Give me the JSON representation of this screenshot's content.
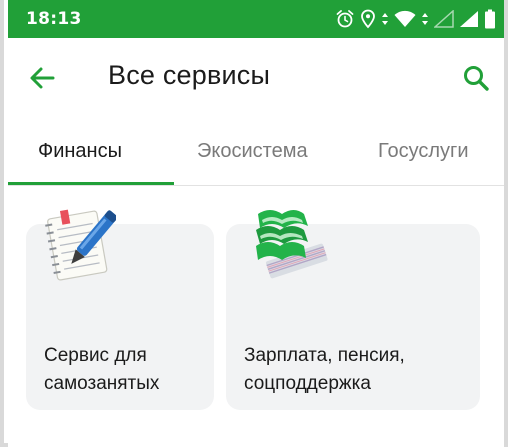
{
  "status_bar": {
    "time": "18:13",
    "icons": [
      "alarm-icon",
      "location-icon",
      "wifi-icon",
      "signal-empty-icon",
      "signal-icon",
      "battery-icon"
    ]
  },
  "app_bar": {
    "title": "Все сервисы",
    "back_icon": "arrow-left-icon",
    "search_icon": "search-icon"
  },
  "tabs": [
    {
      "label": "Финансы",
      "active": true
    },
    {
      "label": "Экосистема",
      "active": false
    },
    {
      "label": "Госуслуги",
      "active": false
    }
  ],
  "cards": [
    {
      "label": "Сервис для\nсамозанятых",
      "icon": "notepad-pen-icon"
    },
    {
      "label": "Зарплата, пенсия,\nсоцподдержка",
      "icon": "money-stack-icon"
    }
  ],
  "colors": {
    "brand_green": "#21a038",
    "card_background": "#f2f3f4",
    "text_primary": "#1b1b1b",
    "text_secondary": "#7a7a7a"
  }
}
